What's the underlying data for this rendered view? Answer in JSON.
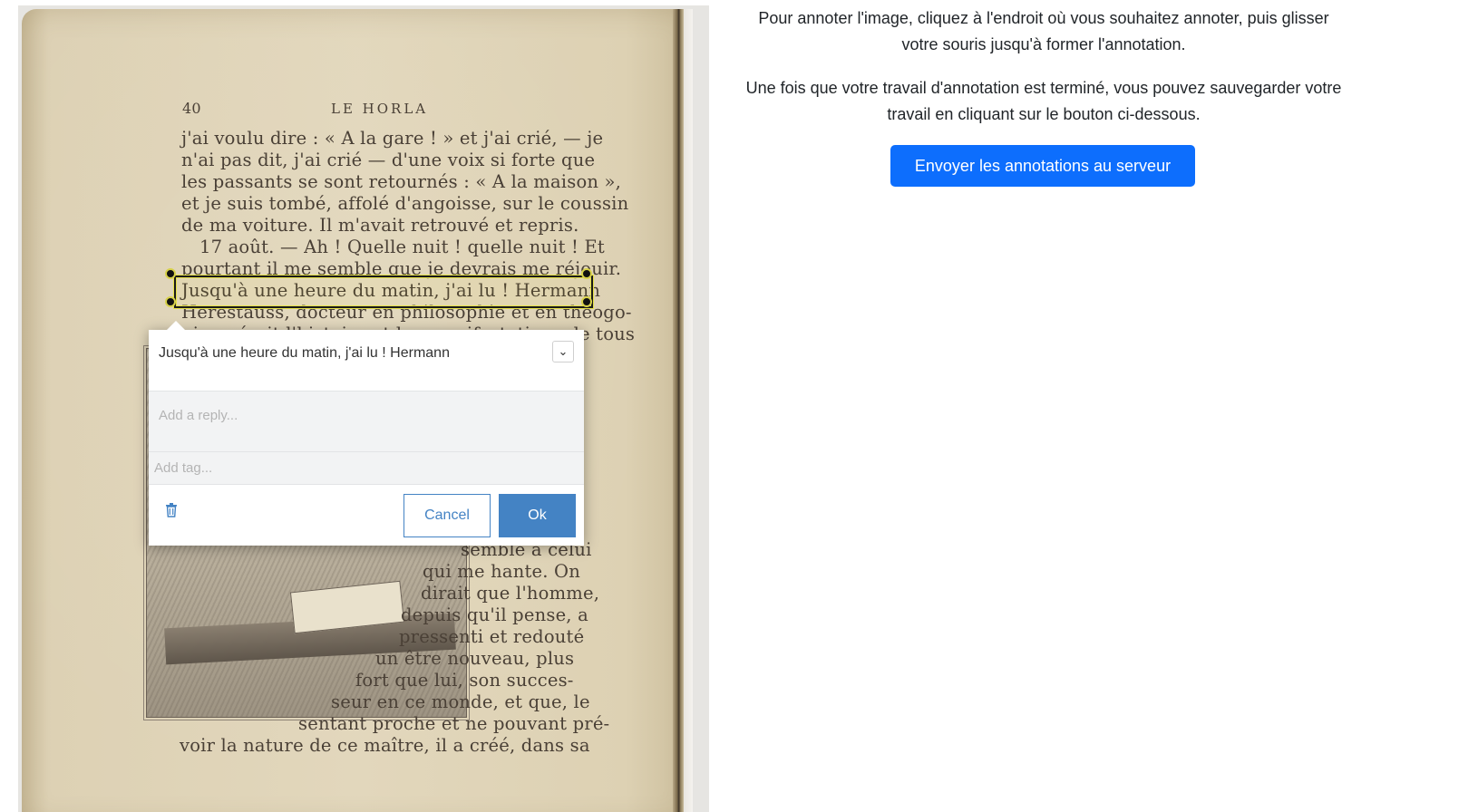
{
  "instructions": {
    "line1": "Pour annoter l'image, cliquez à l'endroit où vous souhaitez annoter, puis glisser",
    "line2": "votre souris jusqu'à former l'annotation.",
    "line3": "Une fois que votre travail d'annotation est terminé, vous pouvez sauvegarder votre",
    "line4": "travail en cliquant sur le bouton ci-dessous.",
    "send_button": "Envoyer les annotations au serveur"
  },
  "book_page": {
    "page_number": "40",
    "running_header": "LE HORLA",
    "lines_top": [
      "j'ai voulu dire : « A la gare ! » et j'ai crié, — je",
      "n'ai pas dit, j'ai crié — d'une voix si forte que",
      "les passants se sont retournés : « A la maison »,",
      "et je suis tombé, affolé d'angoisse, sur le coussin",
      "de ma voiture. Il m'avait retrouvé et repris.",
      "17 août. — Ah ! Quelle nuit ! quelle nuit ! Et",
      "pourtant il me semble que je devrais me réjouir.",
      "Jusqu'à une heure du matin, j'ai lu ! Hermann",
      "Herestauss, docteur en philosophie et en théogo-",
      "nie, a écrit l'histoire et les manifestations de tous"
    ],
    "lines_side": [
      "semble à celui",
      "qui me hante. On",
      "dirait que l'homme,",
      "depuis qu'il pense, a",
      "pressenti et redouté",
      "un être nouveau, plus",
      "fort que lui, son succes-",
      "seur en ce monde, et que, le"
    ],
    "lines_bottom": [
      "sentant proche et ne pouvant pré-",
      "voir la nature de ce maître, il a créé, dans sa"
    ]
  },
  "annotation": {
    "comment": "Jusqu'à une heure du matin, j'ai lu ! Hermann",
    "reply_placeholder": "Add a reply...",
    "tag_placeholder": "Add tag...",
    "cancel_label": "Cancel",
    "ok_label": "Ok",
    "dropdown_icon": "⌄"
  },
  "colors": {
    "primary_button": "#0d6efd",
    "annotator_accent": "#4483c4",
    "selection_outline": "#e6e14a"
  }
}
